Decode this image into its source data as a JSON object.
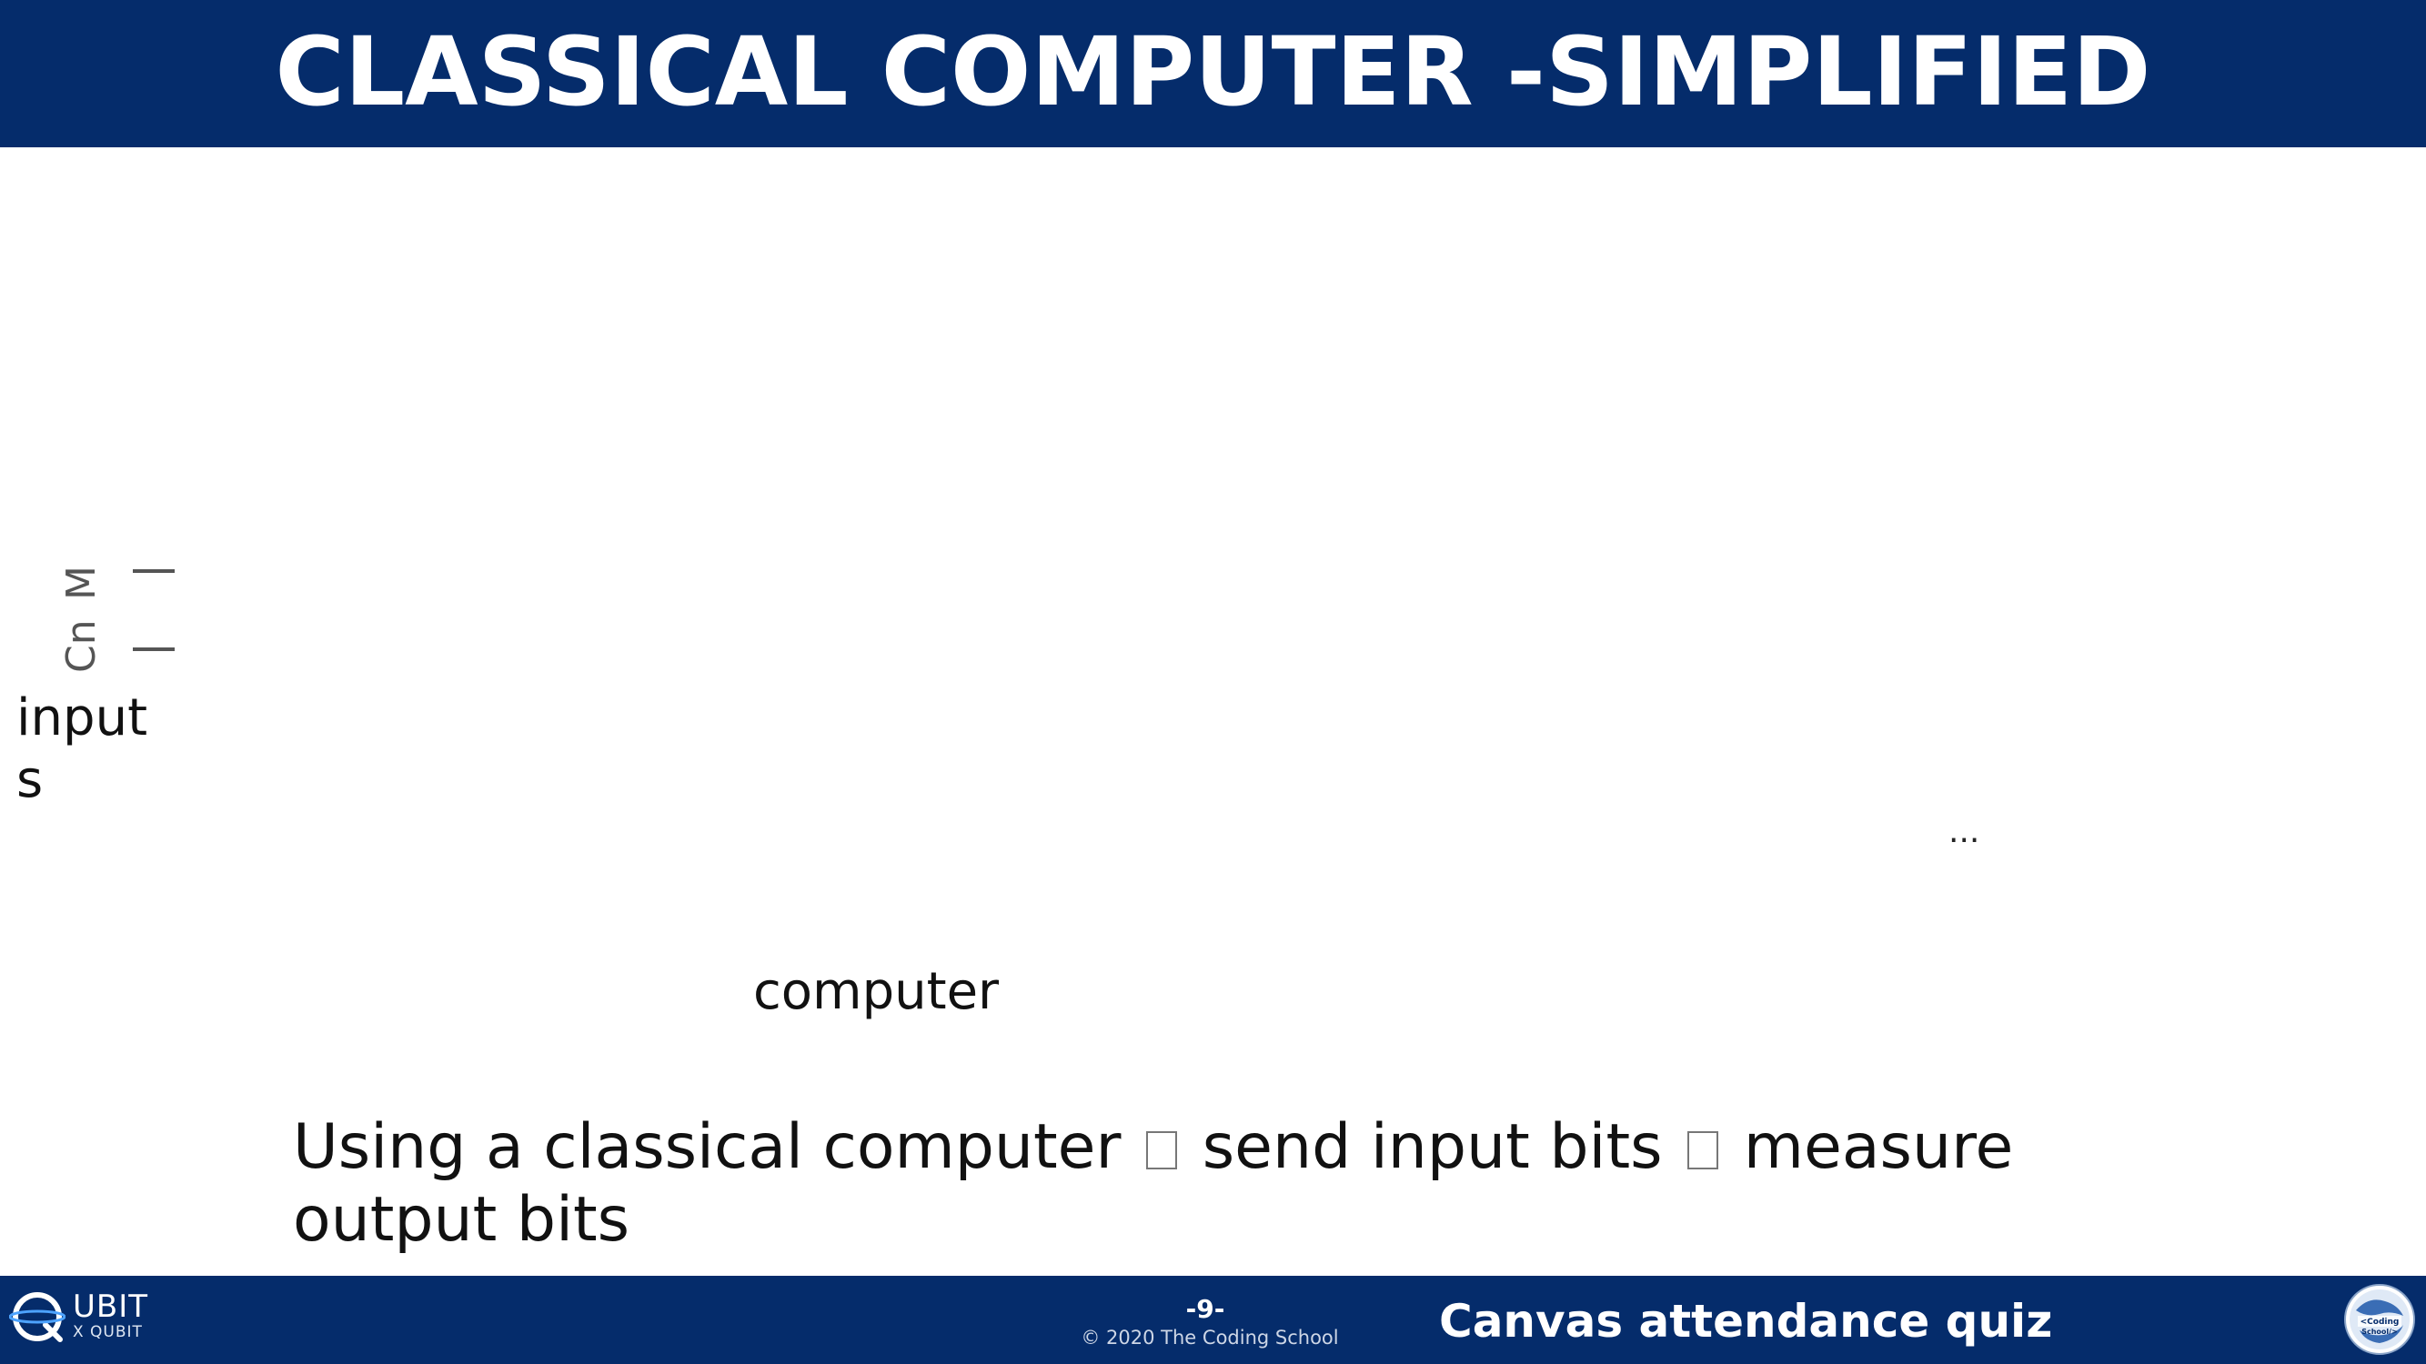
{
  "slide": {
    "title": "CLASSICAL COMPUTER -SIMPLIFIED",
    "rotated_labels": [
      "M",
      "Cn"
    ],
    "inputs_label": "input\ns",
    "dots": "...",
    "computer_label": "computer",
    "caption_parts": [
      "Using a classical computer",
      "send input bits",
      "measure output bits"
    ]
  },
  "footer": {
    "logo_main": "UBIT",
    "logo_sub": "X QUBIT",
    "page_number": "-9-",
    "copyright": "© 2020 The Coding School",
    "quiz_text": "Canvas attendance quiz",
    "school_logo_text": "The Coding School"
  },
  "colors": {
    "header_bg": "#052c6b",
    "footer_bg": "#052c6b",
    "text_dark": "#111111",
    "text_light": "#ffffff"
  }
}
